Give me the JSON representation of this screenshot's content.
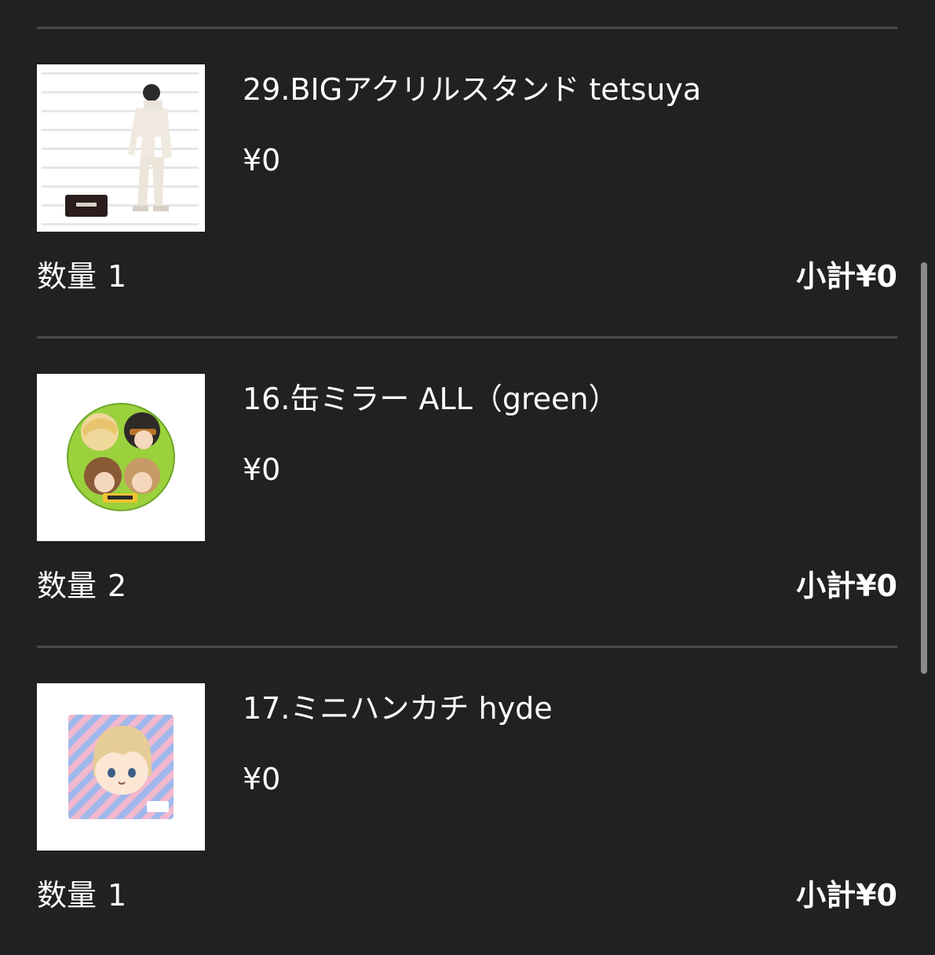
{
  "colors": {
    "background": "#212121",
    "divider": "#4a4a4a",
    "text": "#ffffff",
    "scrollbar": "#8a8a8a"
  },
  "cart": {
    "quantity_label": "数量",
    "subtotal_label": "小計",
    "items": [
      {
        "name": "29.BIGアクリルスタンド tetsuya",
        "price": "¥0",
        "quantity": "1",
        "subtotal": "¥0",
        "image": "acrylic-stand-thumbnail"
      },
      {
        "name": "16.缶ミラー ALL（green）",
        "price": "¥0",
        "quantity": "2",
        "subtotal": "¥0",
        "image": "can-mirror-thumbnail"
      },
      {
        "name": "17.ミニハンカチ hyde",
        "price": "¥0",
        "quantity": "1",
        "subtotal": "¥0",
        "image": "mini-handkerchief-thumbnail"
      }
    ]
  }
}
